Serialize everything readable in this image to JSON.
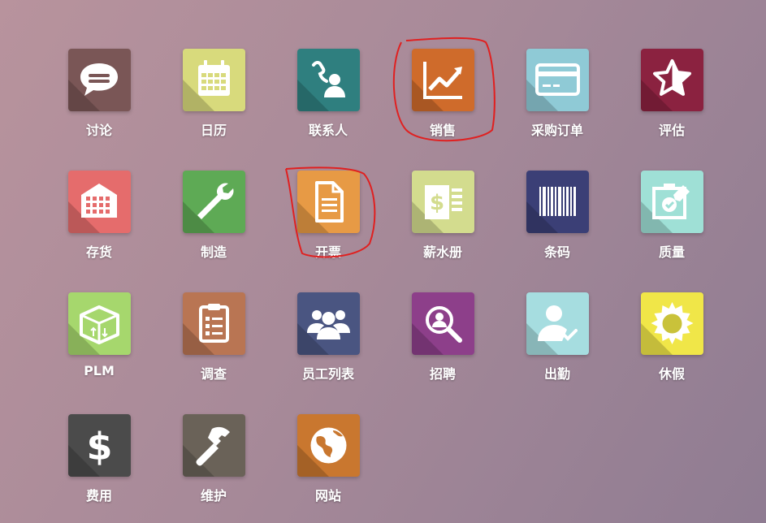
{
  "apps": [
    {
      "label": "讨论",
      "icon": "chat-bubble-icon",
      "color": "#7a5656"
    },
    {
      "label": "日历",
      "icon": "calendar-icon",
      "color": "#d8da7c"
    },
    {
      "label": "联系人",
      "icon": "contact-phone-icon",
      "color": "#2f7f7f"
    },
    {
      "label": "销售",
      "icon": "trend-chart-icon",
      "color": "#cf6b2b"
    },
    {
      "label": "采购订单",
      "icon": "credit-card-icon",
      "color": "#8fcad6"
    },
    {
      "label": "评估",
      "icon": "star-icon",
      "color": "#8b2240"
    },
    {
      "label": "存货",
      "icon": "warehouse-icon",
      "color": "#e56c6c"
    },
    {
      "label": "制造",
      "icon": "wrench-icon",
      "color": "#5eaa55"
    },
    {
      "label": "开票",
      "icon": "document-icon",
      "color": "#e79a45"
    },
    {
      "label": "薪水册",
      "icon": "payslip-icon",
      "color": "#d3dc8e"
    },
    {
      "label": "条码",
      "icon": "barcode-icon",
      "color": "#3b3f76"
    },
    {
      "label": "质量",
      "icon": "quality-check-icon",
      "color": "#9fe0d6"
    },
    {
      "label": "PLM",
      "icon": "box-icon",
      "color": "#a6d76d"
    },
    {
      "label": "调查",
      "icon": "clipboard-icon",
      "color": "#b97553"
    },
    {
      "label": "员工列表",
      "icon": "people-icon",
      "color": "#4a5581"
    },
    {
      "label": "招聘",
      "icon": "magnifier-person-icon",
      "color": "#8d3f8a"
    },
    {
      "label": "出勤",
      "icon": "user-check-icon",
      "color": "#a6dde0"
    },
    {
      "label": "休假",
      "icon": "sun-icon",
      "color": "#f0e648"
    },
    {
      "label": "费用",
      "icon": "dollar-icon",
      "color": "#4b4b4b"
    },
    {
      "label": "维护",
      "icon": "hammer-icon",
      "color": "#6a6258"
    },
    {
      "label": "网站",
      "icon": "globe-icon",
      "color": "#c9772f"
    }
  ],
  "annotation_color": "#e02020"
}
